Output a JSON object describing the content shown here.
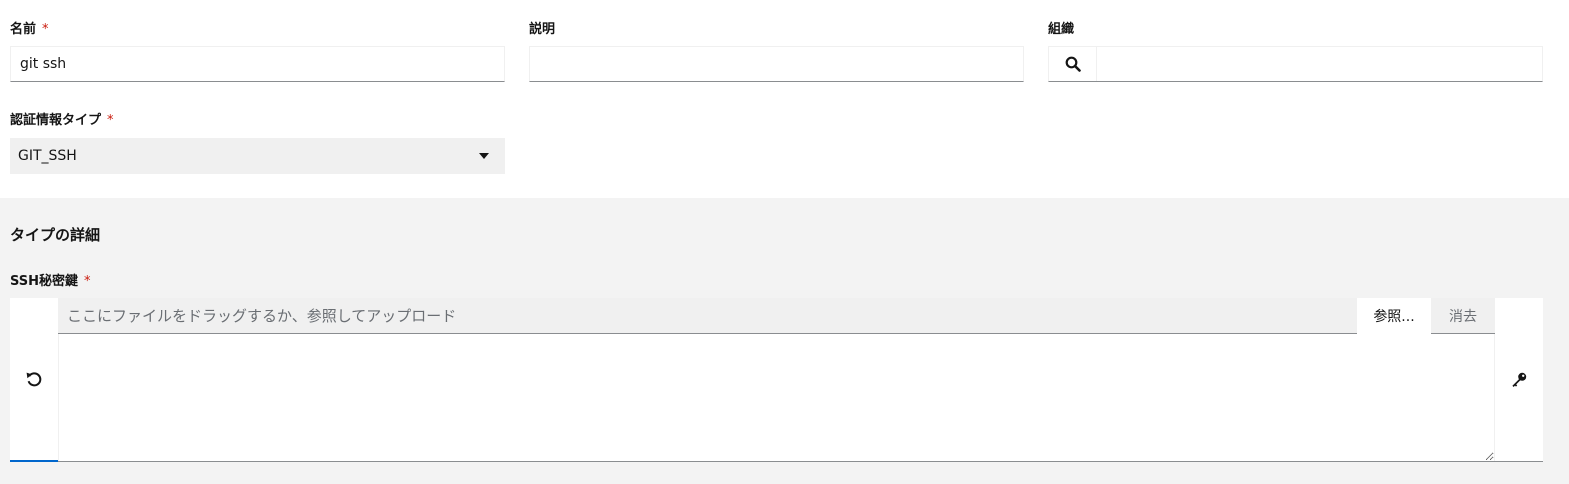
{
  "form": {
    "name": {
      "label": "名前",
      "required_mark": "*",
      "value": "git ssh"
    },
    "description": {
      "label": "説明",
      "value": ""
    },
    "organization": {
      "label": "組織",
      "value": "",
      "icon": "search-icon"
    },
    "credential_type": {
      "label": "認証情報タイプ",
      "required_mark": "*",
      "selected": "GIT_SSH",
      "icon": "caret-down-icon"
    }
  },
  "type_details": {
    "title": "タイプの詳細",
    "ssh_key": {
      "label": "SSH秘密鍵",
      "required_mark": "*",
      "placeholder": "ここにファイルをドラッグするか、参照してアップロード",
      "browse_label": "参照...",
      "clear_label": "消去",
      "value": "",
      "undo_icon": "undo-icon",
      "key_icon": "key-icon"
    }
  },
  "colors": {
    "required": "#c9190b",
    "focus_accent": "#0066cc",
    "section_bg": "#f3f3f3"
  }
}
